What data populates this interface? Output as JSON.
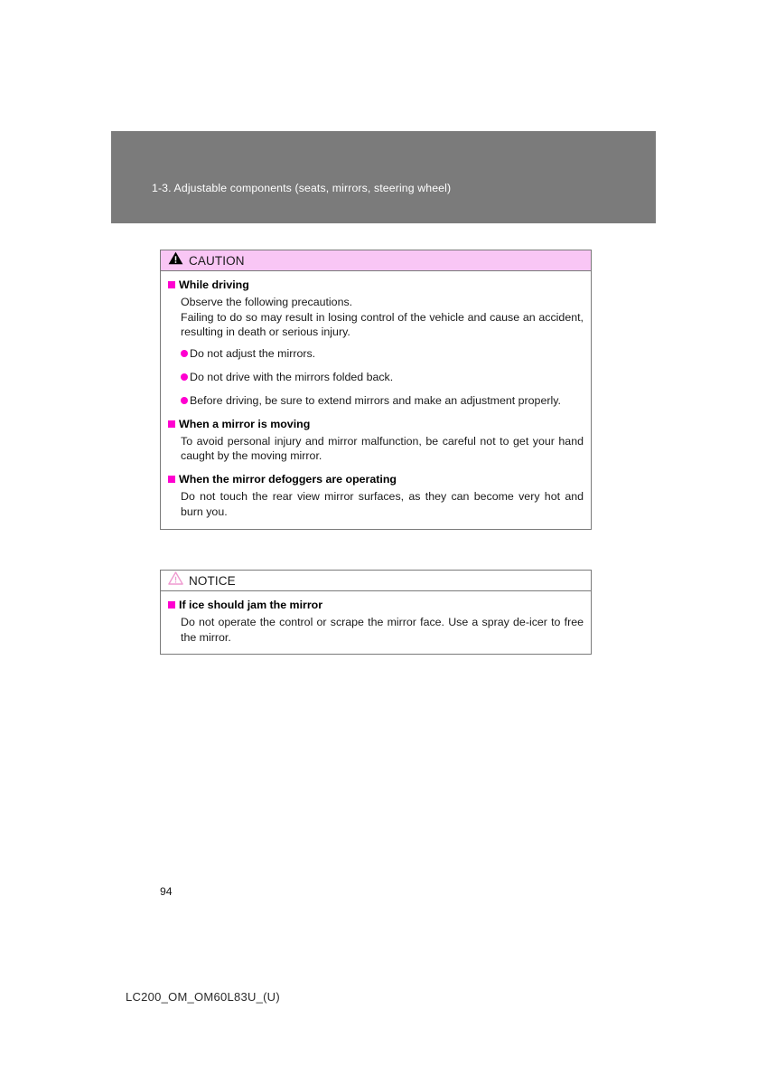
{
  "section_header": {
    "title": "1-3. Adjustable components (seats, mirrors, steering wheel)",
    "background_color": "#7b7b7b",
    "text_color": "#ffffff"
  },
  "caution_box": {
    "icon": "warning-triangle-filled-icon",
    "heading": "CAUTION",
    "header_background": "#f9c6f5",
    "bullet_color": "#ff00d0",
    "sections": [
      {
        "heading": "While driving",
        "paragraphs": [
          "Observe the following precautions.",
          "Failing to do so may result in losing control of the vehicle and cause an accident, resulting in death or serious injury."
        ],
        "bullets": [
          "Do not adjust the mirrors.",
          "Do not drive with the mirrors folded back.",
          "Before driving, be sure to extend mirrors and make an adjustment properly."
        ]
      },
      {
        "heading": "When a mirror is moving",
        "paragraphs": [
          "To avoid personal injury and mirror malfunction, be careful not to get your hand caught by the moving mirror."
        ],
        "bullets": []
      },
      {
        "heading": "When the mirror defoggers are operating",
        "paragraphs": [
          "Do not touch the rear view mirror surfaces, as they can become very hot and burn you."
        ],
        "bullets": []
      }
    ]
  },
  "notice_box": {
    "icon": "warning-triangle-outline-icon",
    "heading": "NOTICE",
    "header_background": "#ffffff",
    "icon_color": "#ef9ad0",
    "sections": [
      {
        "heading": "If ice should jam the mirror",
        "paragraphs": [
          "Do not operate the control or scrape the mirror face. Use a spray de-icer to free the mirror."
        ]
      }
    ]
  },
  "footer": {
    "page_number": "94",
    "document_code": "LC200_OM_OM60L83U_(U)"
  }
}
